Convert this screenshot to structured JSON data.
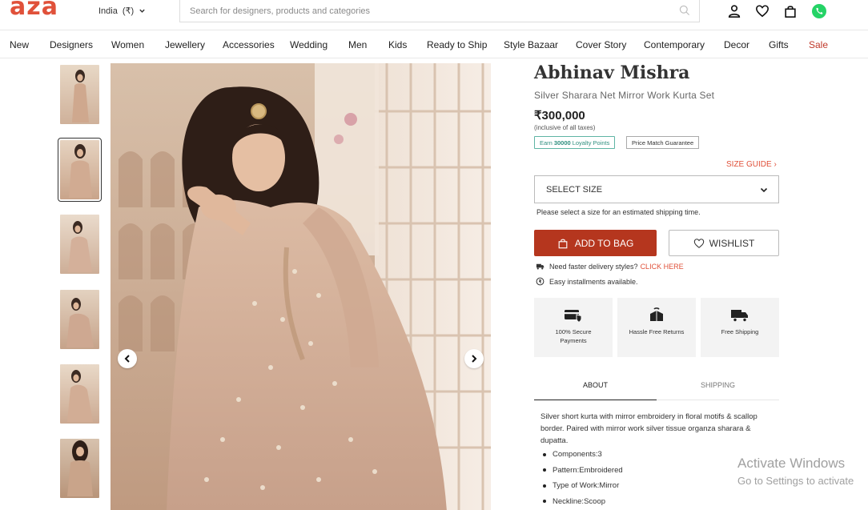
{
  "header": {
    "logo": "aza",
    "country": "India",
    "currency": "(₹)",
    "search_placeholder": "Search for designers, products and categories",
    "icons": [
      "search-icon",
      "user-icon",
      "heart-icon",
      "bag-icon",
      "whatsapp-icon"
    ]
  },
  "nav": {
    "items": [
      "New",
      "Designers",
      "Women",
      "Jewellery",
      "Accessories",
      "Wedding",
      "Men",
      "Kids",
      "Ready to Ship",
      "Style Bazaar",
      "Cover Story",
      "Contemporary",
      "Decor",
      "Gifts",
      "Sale"
    ]
  },
  "gallery": {
    "thumb_count": 6,
    "selected_index": 1
  },
  "product": {
    "brand": "Abhinav Mishra",
    "name": "Silver Sharara Net Mirror Work Kurta Set",
    "price": "₹300,000",
    "tax_note": "(inclusive of all taxes)",
    "loyalty_prefix": "Earn",
    "loyalty_points": "30000",
    "loyalty_suffix": "Loyalty Points",
    "price_match": "Price Match Guarantee",
    "size_guide": "SIZE GUIDE ›",
    "size_select": "SELECT SIZE",
    "size_hint": "Please select a size for an estimated shipping time.",
    "add_to_bag": "ADD TO BAG",
    "wishlist": "WISHLIST",
    "delivery_note": "Need faster delivery styles?",
    "delivery_link": "CLICK HERE",
    "installments": "Easy installments available."
  },
  "features": [
    {
      "label": "100% Secure Payments",
      "icon": "secure-payment-icon"
    },
    {
      "label": "Hassle Free Returns",
      "icon": "returns-icon"
    },
    {
      "label": "Free Shipping",
      "icon": "truck-icon"
    }
  ],
  "tabs": {
    "about": "ABOUT",
    "shipping": "SHIPPING",
    "active": "about"
  },
  "about": {
    "description": "Silver short kurta with mirror embroidery in floral motifs & scallop border. Paired with mirror work silver tissue organza sharara & dupatta.",
    "specs": [
      "Components:3",
      "Pattern:Embroidered",
      "Type of Work:Mirror",
      "Neckline:Scoop"
    ]
  },
  "watermark": {
    "line1": "Activate Windows",
    "line2": "Go to Settings to activate"
  },
  "colors": {
    "brand_accent": "#e0513a",
    "add_to_bag": "#b5361e",
    "loyalty": "#2f8f7f"
  }
}
